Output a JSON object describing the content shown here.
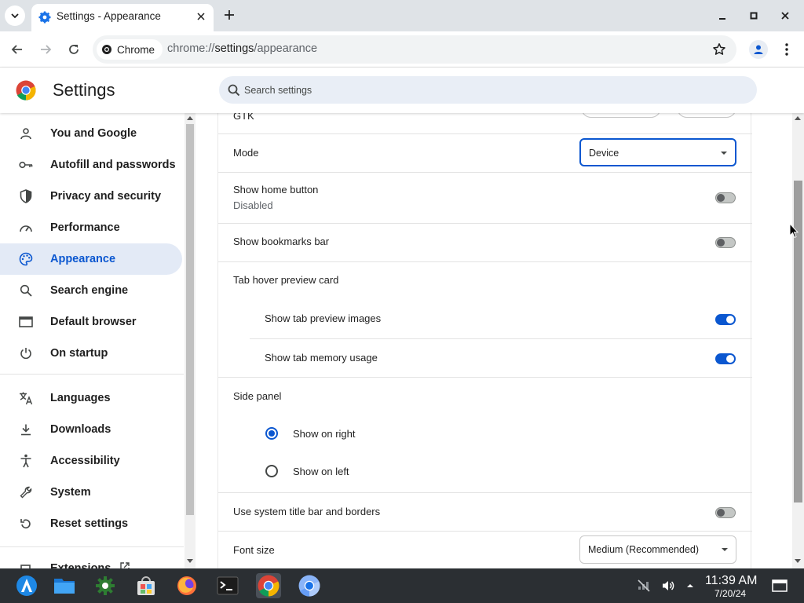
{
  "browser": {
    "tab_title": "Settings - Appearance",
    "chip_label": "Chrome",
    "url_scheme": "chrome://",
    "url_host": "settings",
    "url_path": "/appearance"
  },
  "header": {
    "title": "Settings",
    "search_placeholder": "Search settings"
  },
  "sidebar": {
    "items": [
      {
        "label": "You and Google",
        "icon": "person-icon"
      },
      {
        "label": "Autofill and passwords",
        "icon": "key-icon"
      },
      {
        "label": "Privacy and security",
        "icon": "shield-icon"
      },
      {
        "label": "Performance",
        "icon": "gauge-icon"
      },
      {
        "label": "Appearance",
        "icon": "palette-icon",
        "active": true
      },
      {
        "label": "Search engine",
        "icon": "search-icon"
      },
      {
        "label": "Default browser",
        "icon": "browser-window-icon"
      },
      {
        "label": "On startup",
        "icon": "power-icon"
      },
      {
        "label": "Languages",
        "icon": "translate-icon"
      },
      {
        "label": "Downloads",
        "icon": "download-icon"
      },
      {
        "label": "Accessibility",
        "icon": "accessibility-icon"
      },
      {
        "label": "System",
        "icon": "wrench-icon"
      },
      {
        "label": "Reset settings",
        "icon": "reset-icon"
      },
      {
        "label": "Extensions",
        "icon": "extension-icon"
      }
    ]
  },
  "appearance": {
    "gtk_label": "GTK",
    "mode_label": "Mode",
    "mode_value": "Device",
    "home_button_label": "Show home button",
    "home_button_sub": "Disabled",
    "home_button_on": false,
    "bookmarks_label": "Show bookmarks bar",
    "bookmarks_on": false,
    "hover_card_label": "Tab hover preview card",
    "preview_images_label": "Show tab preview images",
    "preview_images_on": true,
    "memory_usage_label": "Show tab memory usage",
    "memory_usage_on": true,
    "side_panel_label": "Side panel",
    "side_right_label": "Show on right",
    "side_left_label": "Show on left",
    "side_panel_selected": "right",
    "title_bar_label": "Use system title bar and borders",
    "title_bar_on": false,
    "font_size_label": "Font size",
    "font_size_value": "Medium (Recommended)"
  },
  "taskbar": {
    "apps": [
      "launcher-icon",
      "files-icon",
      "settings-gear-icon",
      "software-store-icon",
      "firefox-icon",
      "terminal-icon",
      "chrome-icon",
      "chromium-icon"
    ],
    "time": "11:39 AM",
    "date": "7/20/24"
  },
  "colors": {
    "accent": "#0b57d0",
    "active_nav_bg": "#e3eaf6",
    "taskbar_bg": "#2b2f33"
  }
}
